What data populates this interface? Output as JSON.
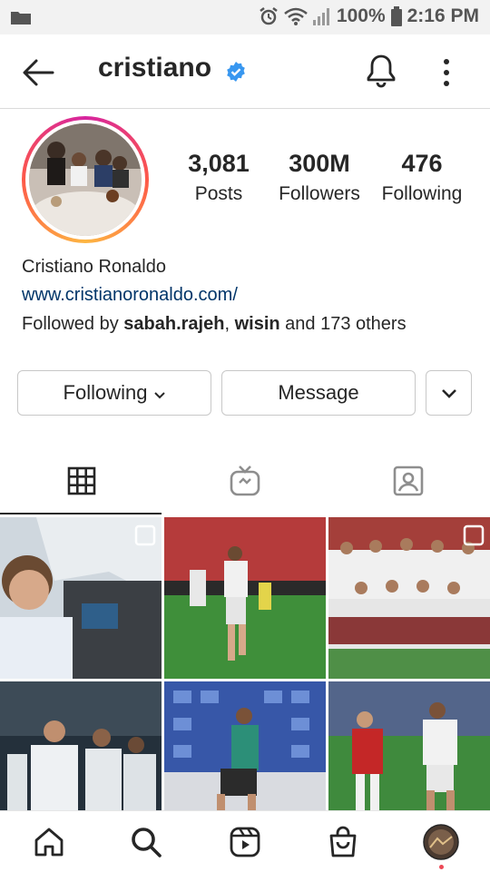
{
  "status_bar": {
    "battery": "100%",
    "time": "2:16 PM",
    "icons": [
      "gallery-icon",
      "alarm-icon",
      "wifi-icon",
      "signal-icon",
      "battery-icon"
    ]
  },
  "header": {
    "username": "cristiano",
    "verified": true,
    "accent_color": "#3897f0"
  },
  "profile": {
    "stats": [
      {
        "value": "3,081",
        "label": "Posts"
      },
      {
        "value": "300M",
        "label": "Followers"
      },
      {
        "value": "476",
        "label": "Following"
      }
    ],
    "full_name": "Cristiano Ronaldo",
    "website": "www.cristianoronaldo.com/",
    "link_color": "#003569",
    "followed_by": {
      "prefix": "Followed by ",
      "user1": "sabah.rajeh",
      "sep": ", ",
      "user2": "wisin",
      "suffix": " and 173 others"
    }
  },
  "actions": {
    "following_label": "Following",
    "message_label": "Message"
  },
  "tabs": [
    {
      "name": "grid",
      "icon": "grid-icon",
      "active": true
    },
    {
      "name": "igtv",
      "icon": "igtv-icon",
      "active": false
    },
    {
      "name": "tagged",
      "icon": "tagged-icon",
      "active": false
    }
  ],
  "grid_posts": [
    {
      "subject": "boy in airplane cockpit",
      "multi": true
    },
    {
      "subject": "football player running on pitch",
      "multi": false
    },
    {
      "subject": "team photo in red-green kits",
      "multi": true
    },
    {
      "subject": "players in tunnel, white tracksuits",
      "multi": false
    },
    {
      "subject": "player training with ball",
      "multi": false
    },
    {
      "subject": "match action, red vs white",
      "multi": false
    }
  ],
  "bottom_nav": [
    {
      "name": "home",
      "icon": "home-icon"
    },
    {
      "name": "search",
      "icon": "search-icon",
      "active": true
    },
    {
      "name": "reels",
      "icon": "reels-icon"
    },
    {
      "name": "shop",
      "icon": "shop-icon"
    },
    {
      "name": "profile",
      "icon": "profile-avatar-icon",
      "notification_dot": true
    }
  ]
}
